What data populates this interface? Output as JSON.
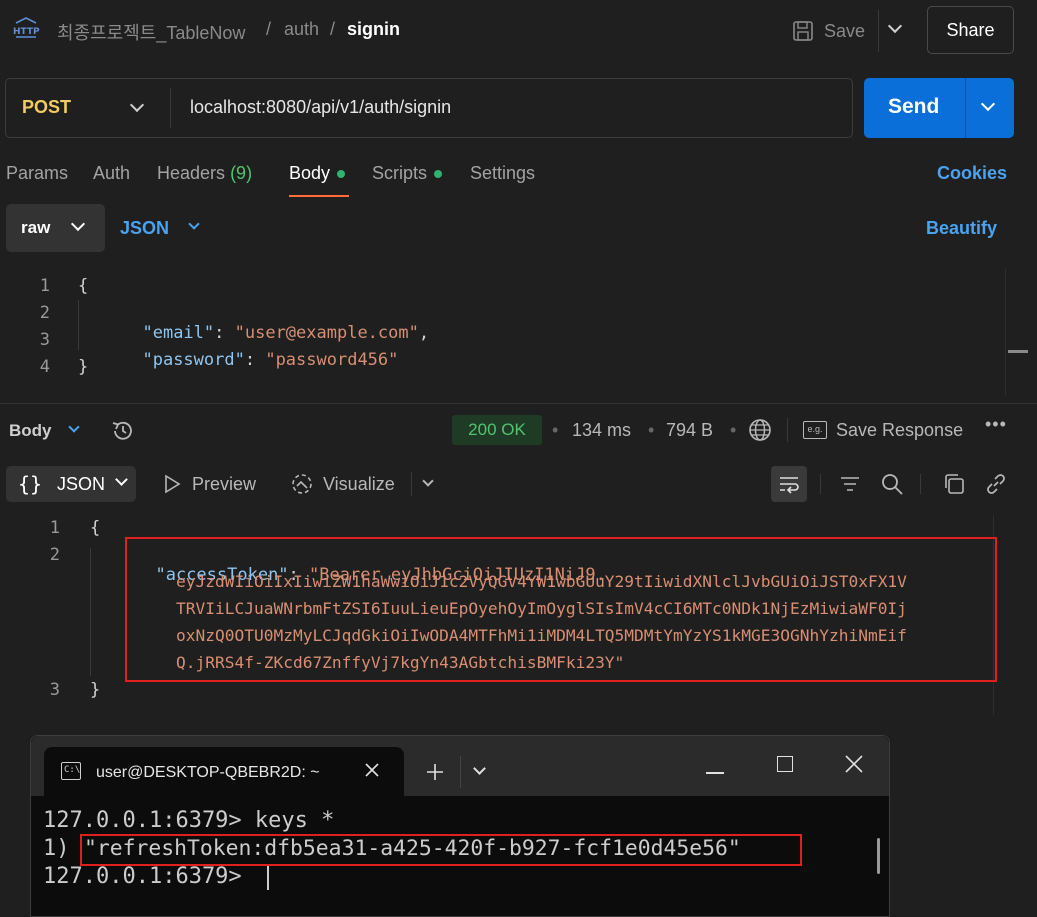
{
  "header": {
    "breadcrumb": [
      "최종프로젝트_TableNow",
      "auth"
    ],
    "current": "signin",
    "separator": "/",
    "save_label": "Save",
    "share_label": "Share",
    "http_icon_text": "HTTP"
  },
  "request": {
    "method": "POST",
    "url": "localhost:8080/api/v1/auth/signin",
    "send_label": "Send"
  },
  "tabs": {
    "params": "Params",
    "auth": "Auth",
    "headers": "Headers",
    "headers_count": "(9)",
    "body": "Body",
    "scripts": "Scripts",
    "settings": "Settings",
    "cookies": "Cookies"
  },
  "body_editor": {
    "mode": "raw",
    "format": "JSON",
    "beautify": "Beautify",
    "line_numbers": [
      "1",
      "2",
      "3",
      "4"
    ],
    "open_brace": "{",
    "close_brace": "}",
    "email_key": "\"email\"",
    "email_value": "\"user@example.com\"",
    "password_key": "\"password\"",
    "password_value": "\"password456\""
  },
  "response": {
    "body_label": "Body",
    "status": "200 OK",
    "time": "134 ms",
    "size": "794 B",
    "save_response": "Save Response",
    "view_format": "JSON",
    "preview": "Preview",
    "visualize": "Visualize",
    "line_numbers": [
      "1",
      "2",
      "3"
    ],
    "open_brace": "{",
    "close_brace": "}",
    "token_key": "\"accessToken\"",
    "token_lines": [
      "\"Bearer eyJhbGciOiJIUzI1NiJ9.",
      "eyJzdWIiOiIxIiwiZW1haWwiOiJ1c2VyQGV4YW1wbGUuY29tIiwidXNlclJvbGUiOiJST0xFX1V",
      "TRVIiLCJuaWNrbmFtZSI6IuuLieuEpOyehOyImOyglSIsImV4cCI6MTc0NDk1NjEzMiwiaWF0Ij",
      "oxNzQ0OTU0MzMyLCJqdGkiOiIwODA4MTFhMi1iMDM4LTQ5MDMtYmYzYS1kMGE3OGNhYzhiNmEif",
      "Q.jRRS4f-ZKcd67ZnffyVj7kgYn43AGbtchisBMFki23Y\""
    ]
  },
  "terminal": {
    "tab_title": "user@DESKTOP-QBEBR2D: ~",
    "line1": "127.0.0.1:6379> keys *",
    "line2_prefix": "1) ",
    "line2_value": "\"refreshToken:dfb5ea31-a425-420f-b927-fcf1e0d45e56\"",
    "line3": "127.0.0.1:6379> "
  },
  "colors": {
    "accent_tab": "#ff6c37",
    "send": "#0a6fd8",
    "status_ok": "#51c46e",
    "highlight_box": "#e01f1f"
  }
}
